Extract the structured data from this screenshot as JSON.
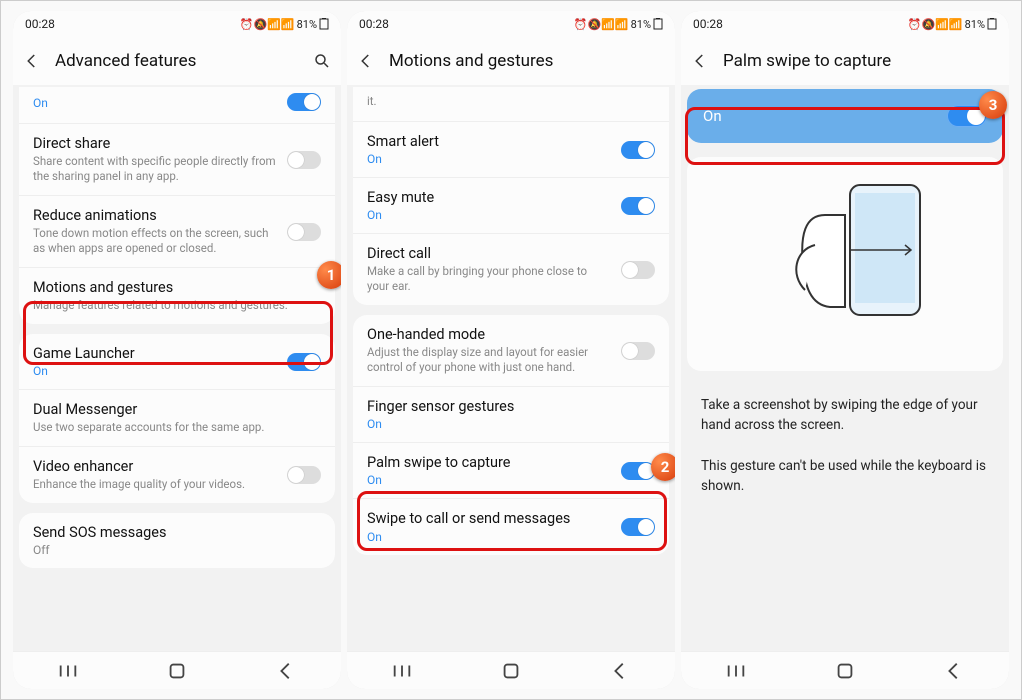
{
  "status": {
    "time": "00:28",
    "battery": "81%",
    "icons": "⏰🔕📶📶"
  },
  "screen1": {
    "title": "Advanced features",
    "truncated_state": "On",
    "rows": [
      {
        "label": "Direct share",
        "sub": "Share content with specific people directly from the sharing panel in any app.",
        "toggle": "off"
      },
      {
        "label": "Reduce animations",
        "sub": "Tone down motion effects on the screen, such as when apps are opened or closed.",
        "toggle": "off"
      },
      {
        "label": "Motions and gestures",
        "sub": "Manage features related to motions and gestures."
      }
    ],
    "rows2": [
      {
        "label": "Game Launcher",
        "state": "On",
        "toggle": "on"
      },
      {
        "label": "Dual Messenger",
        "sub": "Use two separate accounts for the same app."
      },
      {
        "label": "Video enhancer",
        "sub": "Enhance the image quality of your videos.",
        "toggle": "off"
      }
    ],
    "rows3": [
      {
        "label": "Send SOS messages",
        "state": "Off"
      }
    ]
  },
  "screen2": {
    "title": "Motions and gestures",
    "trunc_sub": "it.",
    "rows": [
      {
        "label": "Smart alert",
        "state": "On",
        "toggle": "on"
      },
      {
        "label": "Easy mute",
        "state": "On",
        "toggle": "on"
      },
      {
        "label": "Direct call",
        "sub": "Make a call by bringing your phone close to your ear.",
        "toggle": "off"
      }
    ],
    "rows2": [
      {
        "label": "One-handed mode",
        "sub": "Adjust the display size and layout for easier control of your phone with just one hand.",
        "toggle": "off"
      },
      {
        "label": "Finger sensor gestures",
        "state": "On"
      },
      {
        "label": "Palm swipe to capture",
        "state": "On",
        "toggle": "on"
      },
      {
        "label": "Swipe to call or send messages",
        "state": "On",
        "toggle": "on"
      }
    ]
  },
  "screen3": {
    "title": "Palm swipe to capture",
    "on_label": "On",
    "desc1": "Take a screenshot by swiping the edge of your hand across the screen.",
    "desc2": "This gesture can't be used while the keyboard is shown."
  },
  "badges": {
    "b1": "1",
    "b2": "2",
    "b3": "3"
  }
}
